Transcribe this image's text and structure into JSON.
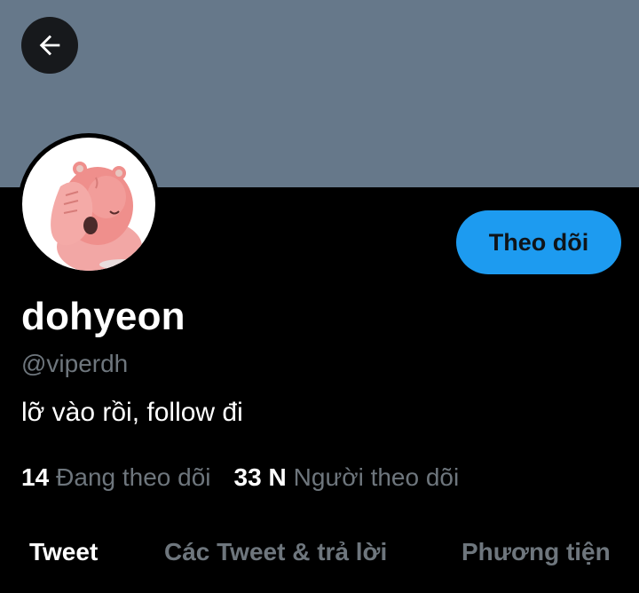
{
  "header": {
    "back_icon": "arrow-left-icon",
    "banner_color": "#66788a"
  },
  "profile": {
    "avatar_icon": "pink-bear-avatar",
    "follow_label": "Theo dõi",
    "display_name": "dohyeon",
    "handle": "@viperdh",
    "bio": "lỡ vào rồi, follow đi",
    "following_count": "14",
    "following_label": "Đang theo dõi",
    "followers_count": "33 N",
    "followers_label": "Người theo dõi"
  },
  "tabs": [
    {
      "label": "Tweet",
      "active": true
    },
    {
      "label": "Các Tweet & trả lời",
      "active": false
    },
    {
      "label": "Phương tiện",
      "active": false
    }
  ],
  "colors": {
    "accent": "#1d9bf0",
    "secondary_text": "#6e767d",
    "background": "#000000"
  }
}
